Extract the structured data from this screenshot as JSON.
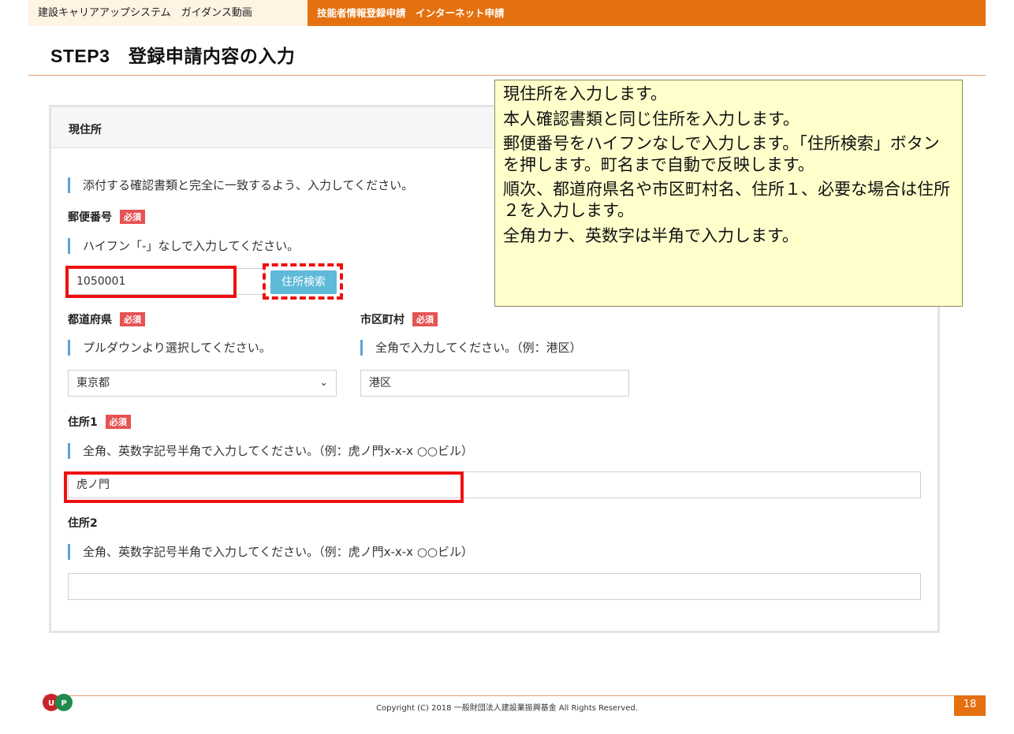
{
  "header": {
    "left_text": "建設キャリアアップシステム　ガイダンス動画",
    "right_text": "技能者情報登録申請　インターネット申請"
  },
  "page_title": "STEP3　登録申請内容の入力",
  "panel": {
    "title": "現住所",
    "intro_note": "添付する確認書類と完全に一致するよう、入力してください。",
    "required_badge": "必須",
    "postal": {
      "label": "郵便番号",
      "note": "ハイフン「-」なしで入力してください。",
      "value": "1050001",
      "search_button": "住所検索"
    },
    "prefecture": {
      "label": "都道府県",
      "note": "プルダウンより選択してください。",
      "selected": "東京都"
    },
    "city": {
      "label": "市区町村",
      "note": "全角で入力してください。（例：港区）",
      "value": "港区"
    },
    "address1": {
      "label": "住所1",
      "note": "全角、英数字記号半角で入力してください。（例：虎ノ門x-x-x ○○ビル）",
      "value": "虎ノ門"
    },
    "address2": {
      "label": "住所2",
      "note": "全角、英数字記号半角で入力してください。（例：虎ノ門x-x-x ○○ビル）",
      "value": ""
    }
  },
  "callout": {
    "lines": [
      "現住所を入力します。",
      "本人確認書類と同じ住所を入力します。",
      "郵便番号をハイフンなしで入力します。「住所検索」ボタンを押します。町名まで自動で反映します。",
      "順次、都道府県名や市区町村名、住所１、必要な場合は住所２を入力します。",
      "全角カナ、英数字は半角で入力します。"
    ]
  },
  "footer": {
    "copyright": "Copyright (C) 2018 一般財団法人建設業振興基金 All Rights Reserved.",
    "page_number": "18"
  },
  "colors": {
    "brand_orange": "#e5700f",
    "highlight_red": "#ee1111",
    "button_blue": "#5fb9d8",
    "callout_yellow": "#ffffcc",
    "required_red": "#e55353"
  }
}
